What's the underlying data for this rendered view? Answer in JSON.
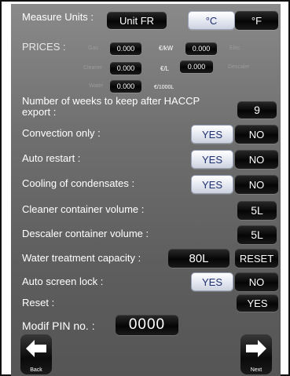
{
  "measure": {
    "label": "Measure Units :",
    "unit_fr": "Unit FR",
    "celsius": "°C",
    "fahrenheit": "°F"
  },
  "prices": {
    "label": "PRICES :",
    "gas_label": "Gas",
    "gas_value": "0.000",
    "per_kw": "€/kW",
    "elec_value": "0.000",
    "elec_label": "Elec",
    "cleaner_label": "Cleaner",
    "cleaner_value": "0.000",
    "per_l": "€/L",
    "descaler_value": "0.000",
    "descaler_label": "Descaler",
    "water_label": "Water",
    "water_value": "0.000",
    "per_1000l": "€/1000L"
  },
  "haccp": {
    "label_line1": "Number of weeks to keep after HACCP",
    "label_line2": "export :",
    "value": "9"
  },
  "convection": {
    "label": "Convection only :",
    "yes": "YES",
    "no": "NO"
  },
  "auto_restart": {
    "label": "Auto restart :",
    "yes": "YES",
    "no": "NO"
  },
  "cooling": {
    "label": "Cooling of condensates :",
    "yes": "YES",
    "no": "NO"
  },
  "cleaner_volume": {
    "label": "Cleaner container volume :",
    "value": "5L"
  },
  "descaler_volume": {
    "label": "Descaler container volume :",
    "value": "5L"
  },
  "water_treatment": {
    "label": "Water treatment capacity :",
    "value": "80L",
    "reset": "RESET"
  },
  "auto_lock": {
    "label": "Auto screen lock :",
    "yes": "YES",
    "no": "NO"
  },
  "reset": {
    "label": "Reset :",
    "yes": "YES"
  },
  "pin": {
    "label": "Modif PIN no. :",
    "value": "0000"
  },
  "nav": {
    "back": "Back",
    "next": "Next"
  }
}
